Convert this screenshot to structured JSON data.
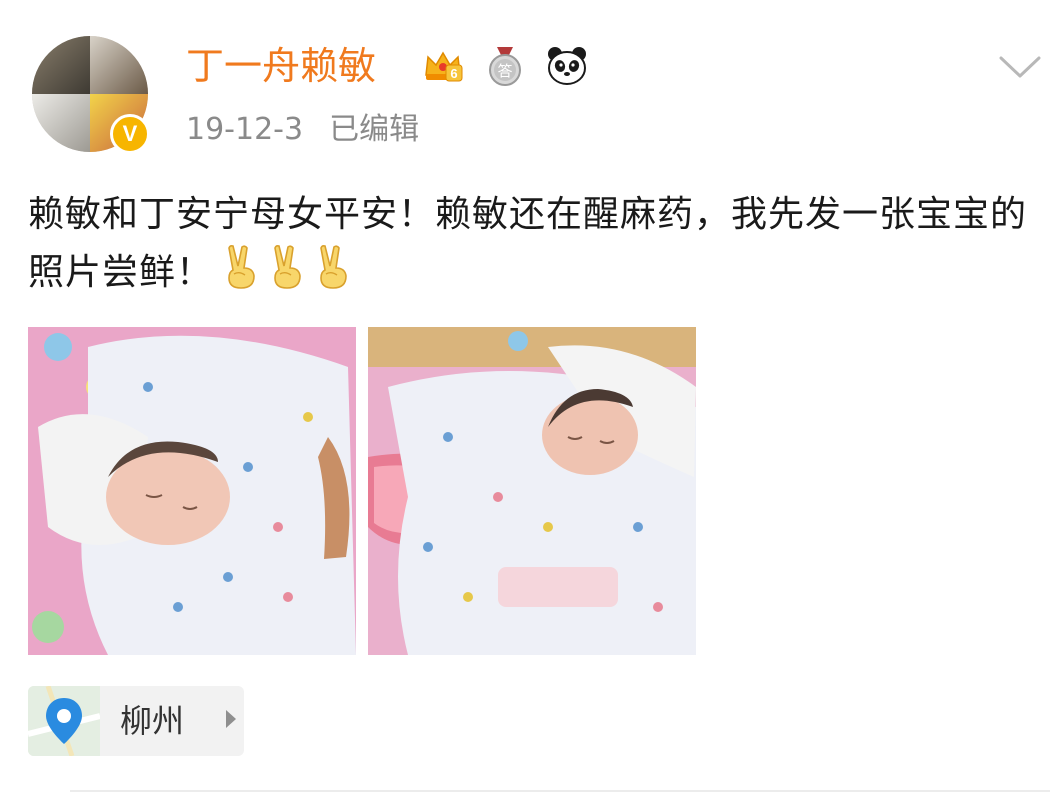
{
  "post": {
    "author": {
      "name": "丁一舟赖敏",
      "avatar_icon": "avatar-collage",
      "verified_icon": "verified-v-icon",
      "verified_mark": "V",
      "badges": [
        "crown-level-badge-icon",
        "medal-answer-badge-icon",
        "panda-badge-icon"
      ],
      "crown_level": "6",
      "medal_char": "答"
    },
    "meta": {
      "date": "19-12-3",
      "edited": "已编辑"
    },
    "text": "赖敏和丁安宁母女平安！赖敏还在醒麻药，我先发一张宝宝的照片尝鲜！",
    "emoji": [
      "victory-hand-icon",
      "victory-hand-icon",
      "victory-hand-icon"
    ],
    "images": [
      {
        "name": "baby-photo-1"
      },
      {
        "name": "baby-photo-2"
      }
    ],
    "location": {
      "label": "柳州",
      "icon": "map-pin-icon"
    }
  },
  "colors": {
    "author_name": "#f07a1e",
    "meta_text": "#8a8a8a",
    "body_text": "#1a1a1a",
    "verified": "#f7b500",
    "location_bg": "#f2f2f2",
    "pin": "#2a8be0"
  }
}
